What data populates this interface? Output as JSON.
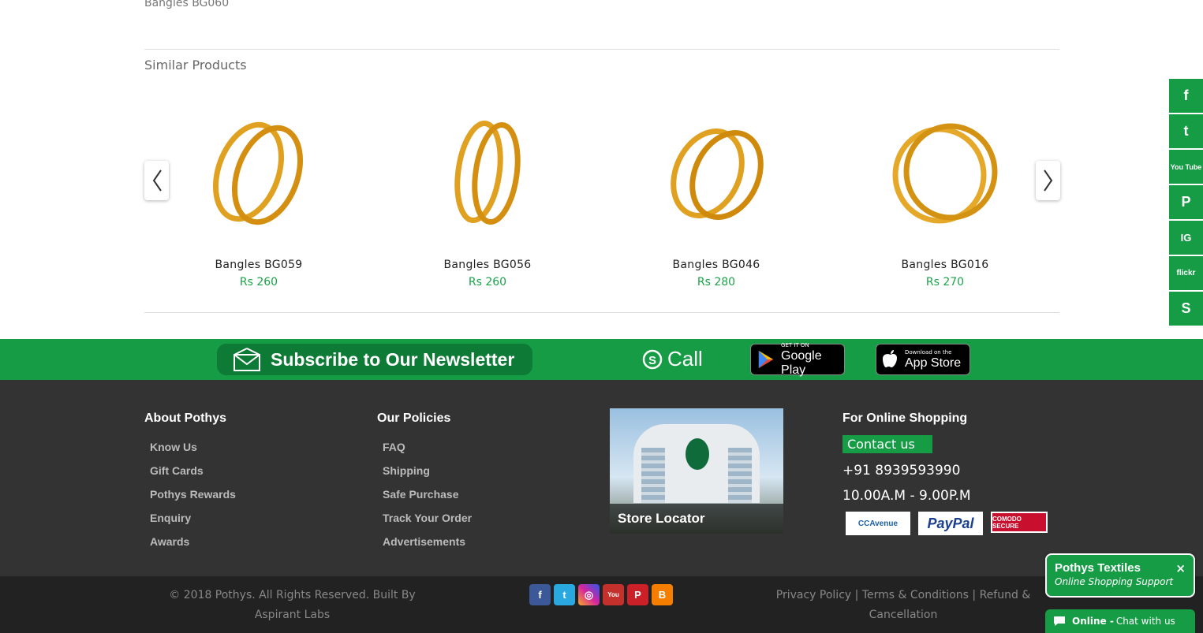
{
  "breadcrumb": "Bangles BG060",
  "similar_title": "Similar Products",
  "products": [
    {
      "name": "Bangles BG059",
      "price": "Rs 260"
    },
    {
      "name": "Bangles BG056",
      "price": "Rs 260"
    },
    {
      "name": "Bangles BG046",
      "price": "Rs 280"
    },
    {
      "name": "Bangles BG016",
      "price": "Rs 270"
    }
  ],
  "green_bar": {
    "newsletter": "Subscribe to Our Newsletter",
    "call": "Call",
    "google_small": "GET IT ON",
    "google_big": "Google Play",
    "apple_small": "Download on the",
    "apple_big": "App Store"
  },
  "footer": {
    "about": {
      "title": "About Pothys",
      "items": [
        "Know Us",
        "Gift Cards",
        "Pothys Rewards",
        "Enquiry",
        "Awards"
      ]
    },
    "policies": {
      "title": "Our Policies",
      "items": [
        "FAQ",
        "Shipping",
        "Safe Purchase",
        "Track Your Order",
        "Advertisements"
      ]
    },
    "store_locator": "Store Locator",
    "online": {
      "title": "For Online Shopping",
      "contact": "Contact us",
      "phone": "+91 8939593990",
      "hours": "10.00A.M - 9.00P.M"
    },
    "payments": [
      "CCAvenue",
      "PayPal",
      "COMODO SECURE"
    ]
  },
  "bottom": {
    "copyright": "© 2018 Pothys. All Rights Reserved. Built By Aspirant Labs",
    "privacy": "Privacy Policy",
    "terms": "Terms & Conditions",
    "refund": "Refund & Cancellation",
    "sep": "|"
  },
  "side_social": [
    "f",
    "t",
    "You Tube",
    "P",
    "IG",
    "flickr",
    "S"
  ],
  "chat": {
    "title": "Pothys Textiles",
    "subtitle": "Online Shopping Support",
    "close": "×",
    "status": "Online -",
    "action": "Chat with us"
  },
  "colors": {
    "brand_green": "#179c46",
    "footer_bg": "#333333",
    "price_green": "#1aa34a"
  }
}
